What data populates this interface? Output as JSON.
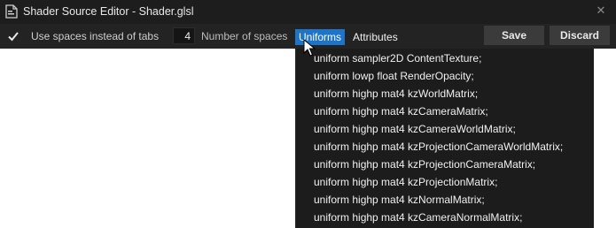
{
  "window": {
    "title": "Shader Source Editor - Shader.glsl"
  },
  "toolbar": {
    "use_spaces_label": "Use spaces instead of tabs",
    "use_spaces_checked": true,
    "spaces_value": "4",
    "spaces_label": "Number of spaces",
    "tabs": [
      {
        "label": "Uniforms",
        "active": true
      },
      {
        "label": "Attributes",
        "active": false
      }
    ],
    "save_label": "Save",
    "discard_label": "Discard"
  },
  "uniforms_menu": {
    "items": [
      "uniform sampler2D ContentTexture;",
      "uniform lowp float RenderOpacity;",
      "uniform highp mat4 kzWorldMatrix;",
      "uniform highp mat4 kzCameraMatrix;",
      "uniform highp mat4 kzCameraWorldMatrix;",
      "uniform highp mat4 kzProjectionCameraWorldMatrix;",
      "uniform highp mat4 kzProjectionCameraMatrix;",
      "uniform highp mat4 kzProjectionMatrix;",
      "uniform highp mat4 kzNormalMatrix;",
      "uniform highp mat4 kzCameraNormalMatrix;"
    ]
  },
  "colors": {
    "active_tab": "#1e74c8",
    "toolbar_bg": "#232323",
    "titlebar_bg": "#1d1d1d",
    "dropdown_bg": "#1c1c1c"
  }
}
